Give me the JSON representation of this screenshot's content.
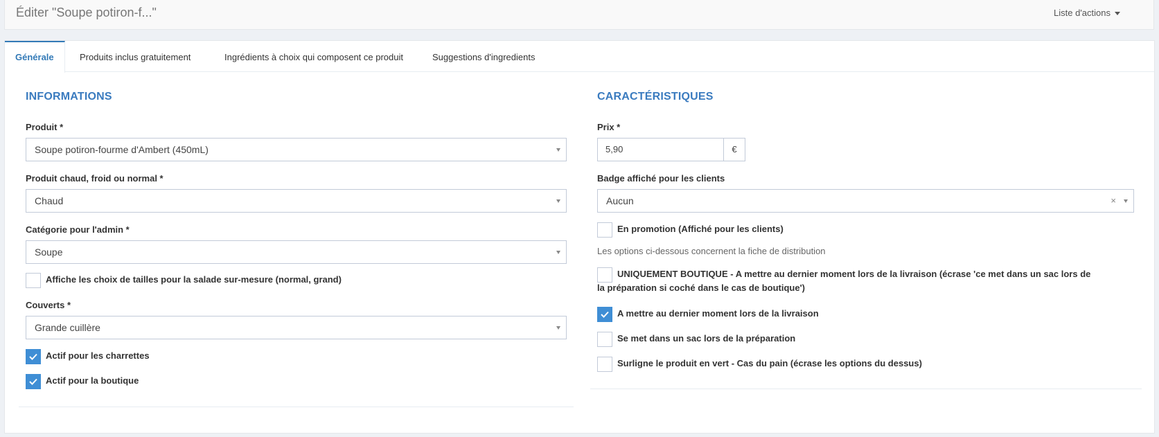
{
  "header": {
    "title": "Éditer \"Soupe potiron-f...\"",
    "actions_label": "Liste d'actions"
  },
  "tabs": [
    {
      "label": "Générale"
    },
    {
      "label": "Produits inclus gratuitement"
    },
    {
      "label": "Ingrédients à choix qui composent ce produit"
    },
    {
      "label": "Suggestions d'ingredients"
    }
  ],
  "informations": {
    "title": "INFORMATIONS",
    "produit": {
      "label": "Produit *",
      "value": "Soupe potiron-fourme d'Ambert (450mL)"
    },
    "temperature": {
      "label": "Produit chaud, froid ou normal *",
      "value": "Chaud"
    },
    "categorie": {
      "label": "Catégorie pour l'admin *",
      "value": "Soupe"
    },
    "tailles": {
      "label": "Affiche les choix de tailles pour la salade sur-mesure (normal, grand)",
      "checked": false
    },
    "couverts": {
      "label": "Couverts *",
      "value": "Grande cuillère"
    },
    "charrettes": {
      "label": "Actif pour les charrettes",
      "checked": true
    },
    "boutique": {
      "label": "Actif pour la boutique",
      "checked": true
    }
  },
  "caracteristiques": {
    "title": "CARACTÉRISTIQUES",
    "prix": {
      "label": "Prix *",
      "value": "5,90",
      "currency": "€"
    },
    "badge": {
      "label": "Badge affiché pour les clients",
      "value": "Aucun",
      "clear": "×"
    },
    "promotion": {
      "label": "En promotion (Affiché pour les clients)",
      "checked": false
    },
    "note": "Les options ci-dessous concernent la fiche de distribution",
    "uniquement": {
      "strong": "UNIQUEMENT BOUTIQUE",
      "rest": " - A mettre au dernier moment lors de la livraison (écrase 'ce met dans un sac lors de la préparation si coché dans le cas de boutique')",
      "checked": false
    },
    "dernier": {
      "label": "A mettre au dernier moment lors de la livraison",
      "checked": true
    },
    "sac": {
      "label": "Se met dans un sac lors de la préparation",
      "checked": false
    },
    "surligne": {
      "label": "Surligne le produit en vert - Cas du pain (écrase les options du dessus)",
      "checked": false
    }
  },
  "colors": {
    "accent": "#3a7bbf",
    "checkbox": "#3f8ed5"
  }
}
